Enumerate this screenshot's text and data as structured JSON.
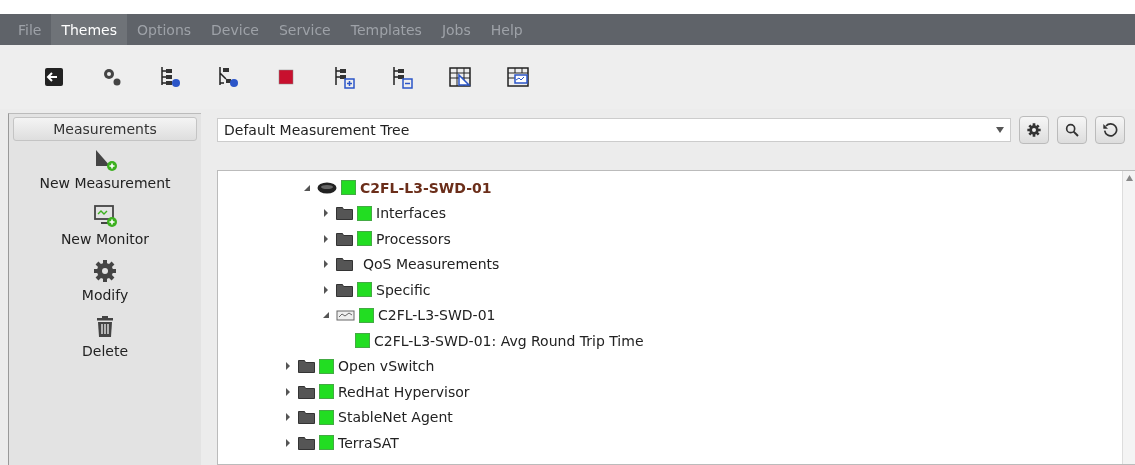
{
  "menu": [
    {
      "label": "File",
      "selected": false
    },
    {
      "label": "Themes",
      "selected": true
    },
    {
      "label": "Options",
      "selected": false
    },
    {
      "label": "Device",
      "selected": false
    },
    {
      "label": "Service",
      "selected": false
    },
    {
      "label": "Templates",
      "selected": false
    },
    {
      "label": "Jobs",
      "selected": false
    },
    {
      "label": "Help",
      "selected": false
    }
  ],
  "sidebar": {
    "title": "Measurements",
    "actions": [
      {
        "kind": "new-measurement",
        "label": "New Measurement"
      },
      {
        "kind": "new-monitor",
        "label": "New Monitor"
      },
      {
        "kind": "modify",
        "label": "Modify"
      },
      {
        "kind": "delete",
        "label": "Delete"
      }
    ]
  },
  "tree_selector": {
    "value": "Default Measurement Tree"
  },
  "tree": {
    "scrolled_branch": [
      {
        "kind": "device",
        "label": "C2FL-L3-SWD-01",
        "color": "#22dd22",
        "expanded": true,
        "children": [
          {
            "kind": "folder",
            "label": "Interfaces",
            "color": "#22dd22",
            "expanded": false
          },
          {
            "kind": "folder",
            "label": "Processors",
            "color": "#22dd22",
            "expanded": false
          },
          {
            "kind": "folder",
            "label": "QoS Measurements",
            "expanded": false
          },
          {
            "kind": "folder",
            "label": "Specific",
            "color": "#22dd22",
            "expanded": false
          },
          {
            "kind": "monitor",
            "label": "C2FL-L3-SWD-01",
            "color": "#22dd22",
            "expanded": true,
            "children": [
              {
                "label": "C2FL-L3-SWD-01: Avg Round Trip Time",
                "color": "#22dd22"
              }
            ]
          }
        ]
      }
    ],
    "nodes": [
      {
        "kind": "folder",
        "label": "Open vSwitch",
        "color": "#22dd22",
        "expanded": false
      },
      {
        "kind": "folder",
        "label": "RedHat Hypervisor",
        "color": "#22dd22",
        "expanded": false
      },
      {
        "kind": "folder",
        "label": "StableNet Agent",
        "color": "#22dd22",
        "expanded": false
      },
      {
        "kind": "folder",
        "label": "TerraSAT",
        "color": "#22dd22",
        "expanded": false
      }
    ]
  }
}
